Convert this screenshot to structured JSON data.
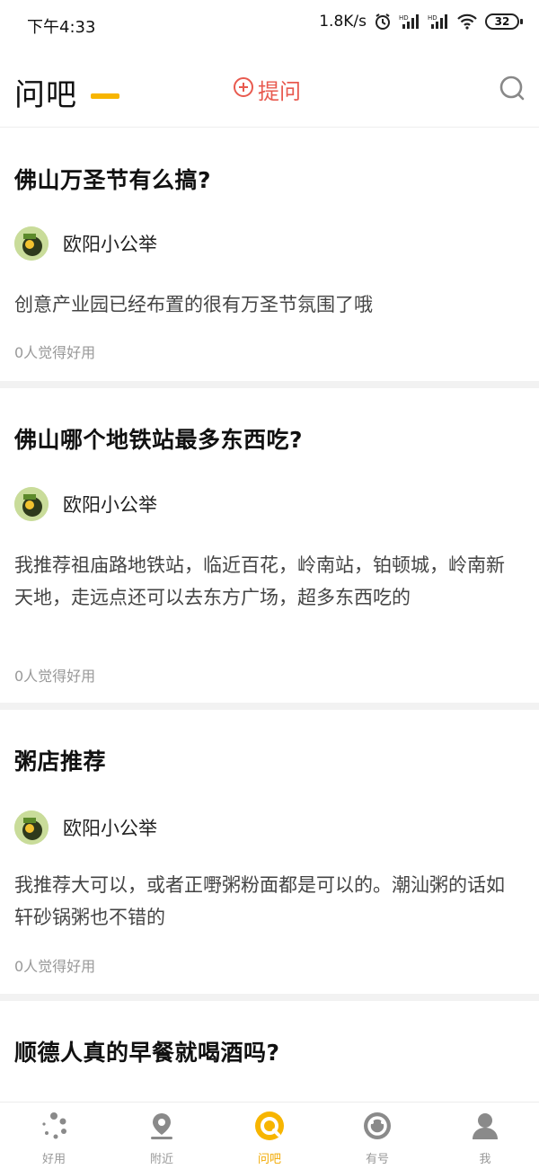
{
  "status_bar": {
    "time": "下午4:33",
    "network_speed": "1.8K/s",
    "battery": "32"
  },
  "header": {
    "title": "问吧",
    "ask_label": "提问",
    "accent_color": "#f7b500",
    "ask_color": "#e85a4f"
  },
  "feed": [
    {
      "question": "佛山万圣节有么搞?",
      "author": "欧阳小公举",
      "answer": "创意产业园已经布置的很有万圣节氛围了哦",
      "likes": "0人觉得好用"
    },
    {
      "question": "佛山哪个地铁站最多东西吃?",
      "author": "欧阳小公举",
      "answer": "我推荐祖庙路地铁站，临近百花，岭南站，铂顿城，岭南新天地，走远点还可以去东方广场，超多东西吃的",
      "likes": "0人觉得好用"
    },
    {
      "question": "粥店推荐",
      "author": "欧阳小公举",
      "answer": "我推荐大可以，或者正嘢粥粉面都是可以的。潮汕粥的话如轩砂锅粥也不错的",
      "likes": "0人觉得好用"
    },
    {
      "question": "顺德人真的早餐就喝酒吗?"
    }
  ],
  "tabs": [
    {
      "label": "好用",
      "icon": "dots-icon"
    },
    {
      "label": "附近",
      "icon": "location-icon"
    },
    {
      "label": "问吧",
      "icon": "ask-icon",
      "active": true
    },
    {
      "label": "有号",
      "icon": "smile-icon"
    },
    {
      "label": "我",
      "icon": "person-icon"
    }
  ]
}
